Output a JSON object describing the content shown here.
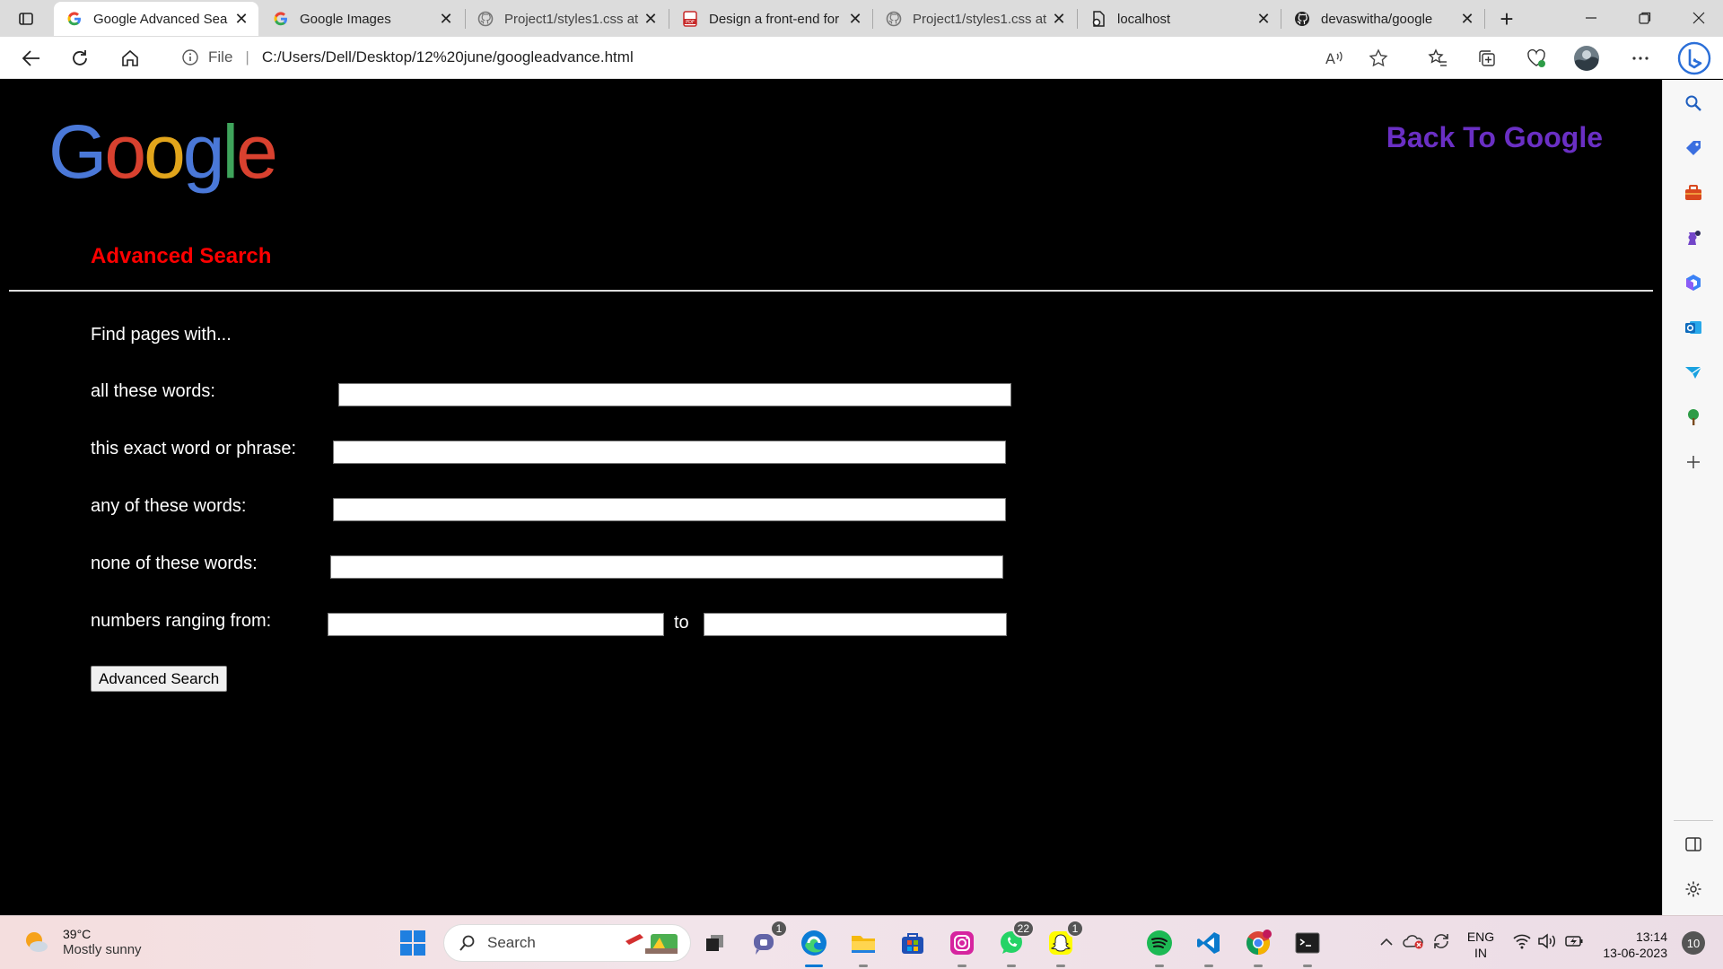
{
  "browser": {
    "tabs": [
      {
        "title": "Google Advanced Sea",
        "active": true,
        "icon": "google-icon"
      },
      {
        "title": "Google Images",
        "active": false,
        "icon": "google-icon"
      },
      {
        "title": "Project1/styles1.css at",
        "active": false,
        "icon": "github-icon"
      },
      {
        "title": "Design a front-end for",
        "active": false,
        "icon": "pdf-icon"
      },
      {
        "title": "Project1/styles1.css at",
        "active": false,
        "icon": "github-icon"
      },
      {
        "title": "localhost",
        "active": false,
        "icon": "page-icon"
      },
      {
        "title": "devaswitha/google",
        "active": false,
        "icon": "github-icon"
      }
    ],
    "address": {
      "scheme_label": "File",
      "url": "C:/Users/Dell/Desktop/12%20june/googleadvance.html"
    }
  },
  "page": {
    "logo": {
      "letters": [
        "G",
        "o",
        "o",
        "g",
        "l",
        "e"
      ],
      "colors": [
        "#4a78d8",
        "#d9412f",
        "#e2a51b",
        "#4a78d8",
        "#3fa45b",
        "#d9412f"
      ]
    },
    "back_link": "Back To Google",
    "title": "Advanced Search",
    "intro": "Find pages with...",
    "fields": {
      "all_words_label": "all these words:",
      "exact_phrase_label": "this exact word or phrase:",
      "any_words_label": "any of these words:",
      "none_words_label": "none of these words:",
      "range_label": "numbers ranging from:",
      "range_to": "to"
    },
    "submit_label": "Advanced Search",
    "colors": {
      "title": "#ff0000",
      "back_link": "#6a2fc4",
      "background": "#000000"
    }
  },
  "taskbar": {
    "weather": {
      "temp": "39°C",
      "desc": "Mostly sunny"
    },
    "search_label": "Search",
    "badges": {
      "teams": "1",
      "whatsapp": "22",
      "snapchat": "1"
    },
    "lang": {
      "line1": "ENG",
      "line2": "IN"
    },
    "clock": {
      "time": "13:14",
      "date": "13-06-2023"
    },
    "notifications": "10"
  }
}
